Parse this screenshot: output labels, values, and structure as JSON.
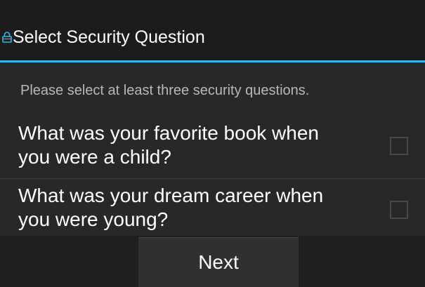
{
  "dialog": {
    "title": "Select Security Question",
    "title_icon": "lock-icon",
    "instructions": "Please select at least three security questions."
  },
  "questions": [
    {
      "text": "What was your favorite book when you were a child?",
      "checked": false
    },
    {
      "text": "What was your dream career when you were young?",
      "checked": false
    }
  ],
  "actions": {
    "next_label": "Next"
  },
  "colors": {
    "accent": "#33b5e5",
    "background": "#282828",
    "titlebar": "#1c1c1c"
  }
}
